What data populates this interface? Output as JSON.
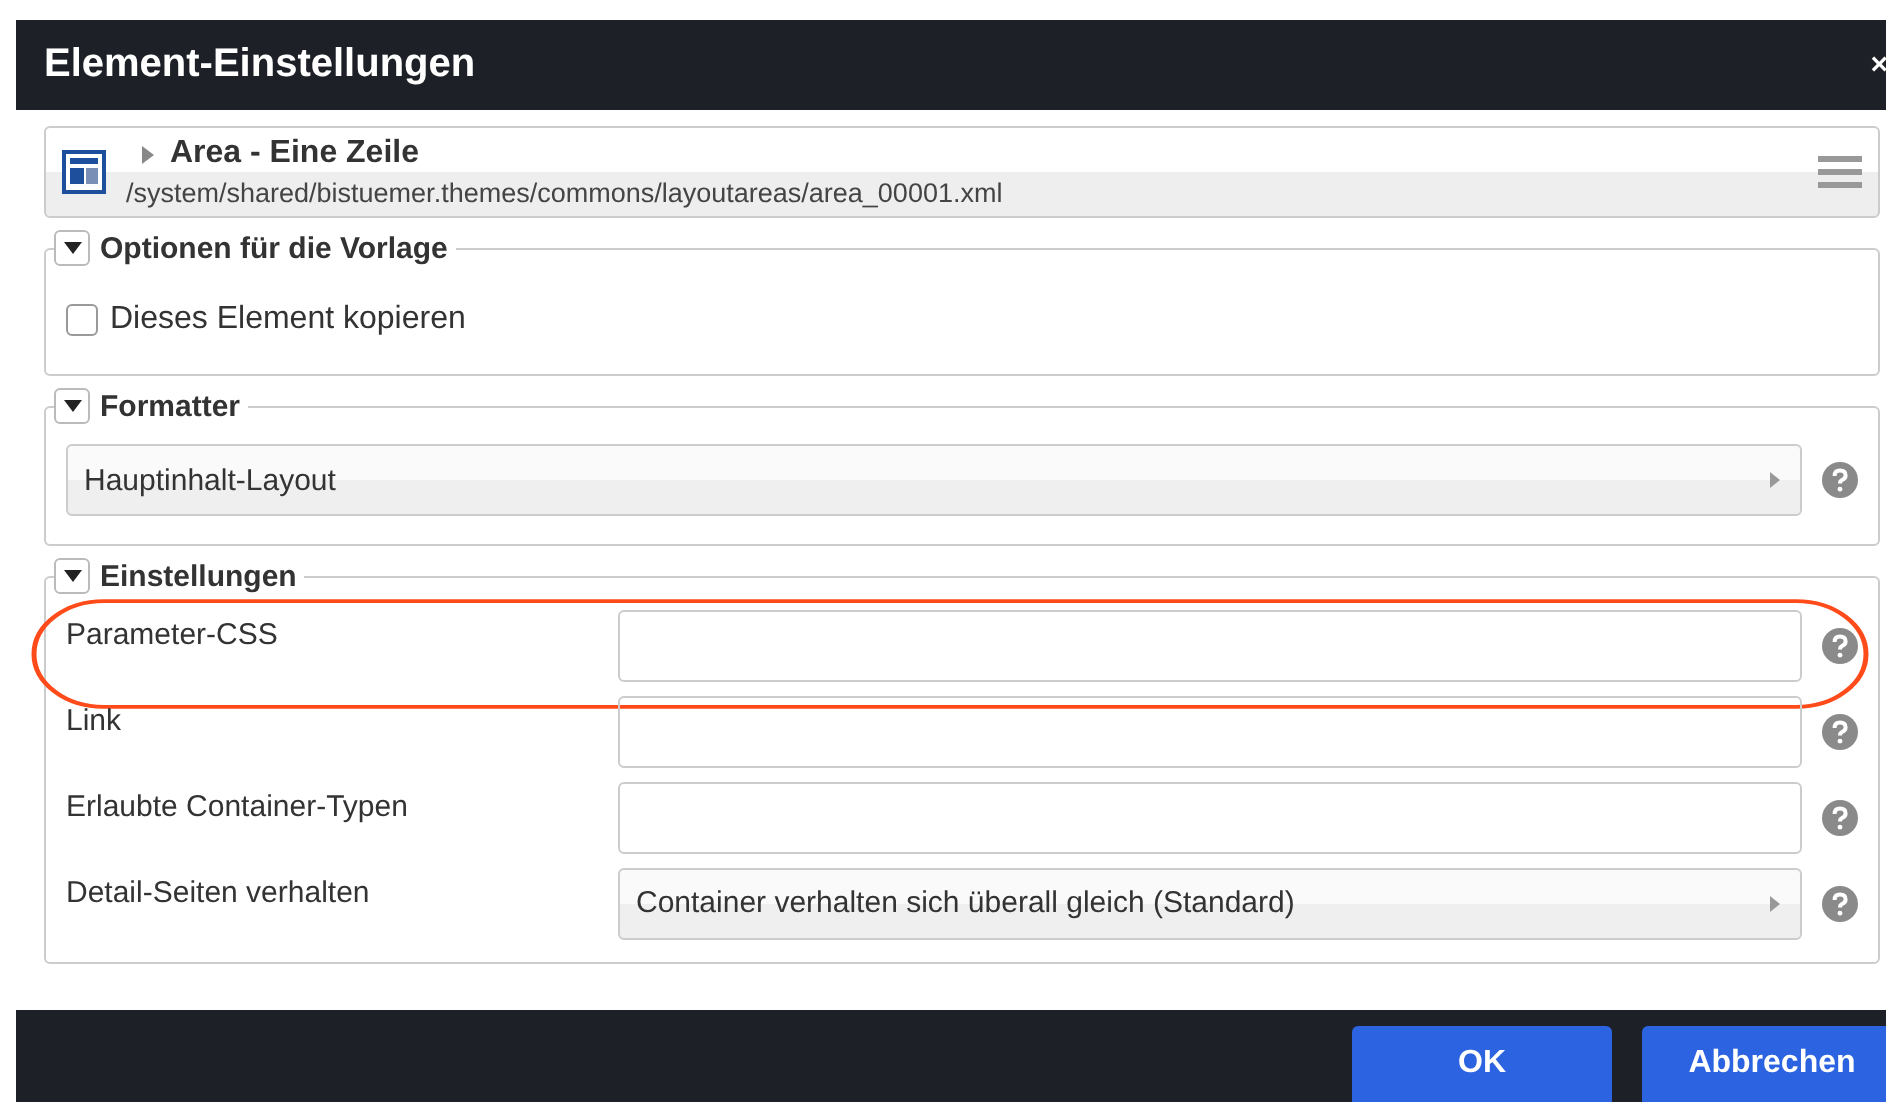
{
  "window": {
    "title": "Element-Einstellungen",
    "close": "×"
  },
  "resource": {
    "title": "Area - Eine Zeile",
    "path": "/system/shared/bistuemer.themes/commons/layoutareas/area_00001.xml"
  },
  "sections": [
    {
      "title": "Optionen für die Vorlage",
      "expanded": true,
      "rows": [
        {
          "kind": "checkbox",
          "label": "Dieses Element kopieren",
          "checked": false
        }
      ]
    },
    {
      "title": "Formatter",
      "expanded": true,
      "rows": [
        {
          "kind": "select",
          "value": "Hauptinhalt-Layout"
        }
      ]
    },
    {
      "title": "Einstellungen",
      "expanded": true,
      "rows": [
        {
          "kind": "text",
          "label": "Parameter-CSS",
          "highlighted": true
        },
        {
          "kind": "text",
          "label": "Link",
          "highlighted": false
        },
        {
          "kind": "text",
          "label": "Erlaubte Container-Typen",
          "highlighted": false
        },
        {
          "kind": "select",
          "label": "Detail-Seiten verhalten",
          "value": "Container verhalten sich überall gleich (Standard)"
        }
      ]
    }
  ],
  "buttons": [
    {
      "label": "OK"
    },
    {
      "label": "Abbrechen"
    }
  ]
}
